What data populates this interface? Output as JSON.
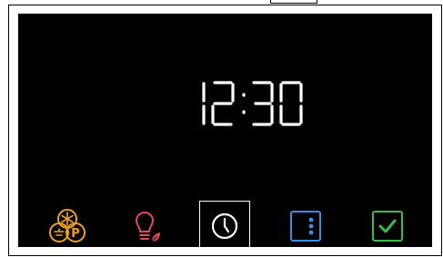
{
  "display": {
    "time": "12:30",
    "digit_color": "#ffffff"
  },
  "controls": [
    {
      "id": "mode",
      "icon": "fan-p-mode-icon",
      "color": "#f0a020",
      "selected": false
    },
    {
      "id": "light",
      "icon": "bulb-leaf-icon",
      "color": "#e64a5a",
      "selected": false
    },
    {
      "id": "timer",
      "icon": "clock-icon",
      "color": "#ffffff",
      "selected": true
    },
    {
      "id": "menu",
      "icon": "more-vertical-icon",
      "color": "#3a8fe8",
      "selected": false
    },
    {
      "id": "confirm",
      "icon": "check-icon",
      "color": "#3dbb4a",
      "selected": false
    }
  ],
  "colors": {
    "screen_bg": "#000000",
    "frame": "#000000",
    "page_bg": "#ffffff"
  }
}
